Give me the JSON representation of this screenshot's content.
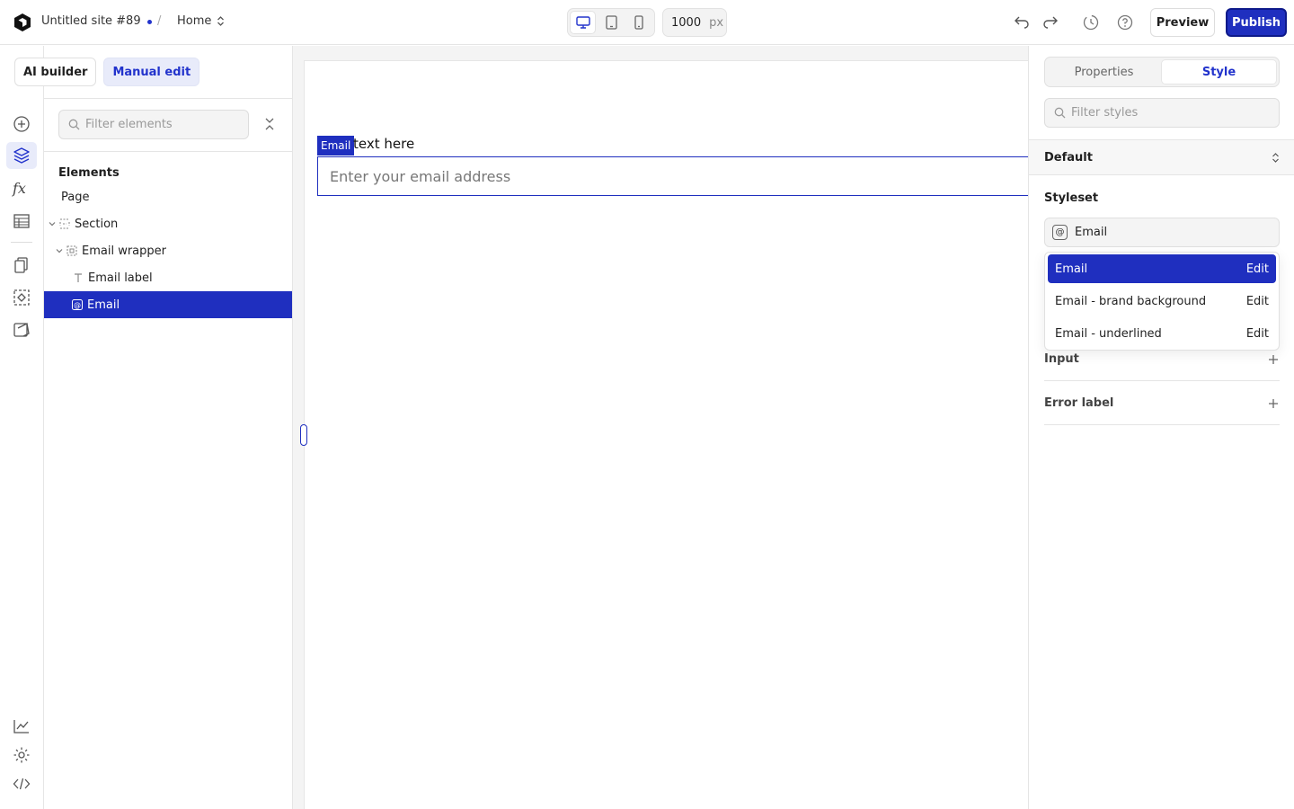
{
  "topbar": {
    "site_name": "Untitled site #89",
    "separator": "/",
    "page": "Home",
    "canvas_width": "1000",
    "canvas_unit": "px",
    "preview_label": "Preview",
    "publish_label": "Publish"
  },
  "left_panel": {
    "mode_tabs": [
      "AI builder",
      "Manual edit"
    ],
    "filter_placeholder": "Filter elements",
    "elements_title": "Elements",
    "tree": [
      {
        "label": "Page"
      },
      {
        "label": "Section"
      },
      {
        "label": "Email wrapper"
      },
      {
        "label": "Email label"
      },
      {
        "label": "Email"
      }
    ]
  },
  "canvas": {
    "element_tag": "Email",
    "label_text": "text here",
    "input_placeholder": "Enter your email address"
  },
  "right_panel": {
    "tabs": [
      "Properties",
      "Style"
    ],
    "filter_placeholder": "Filter styles",
    "state": "Default",
    "styleset_title": "Styleset",
    "styleset_badge": "@",
    "styleset_selected": "Email",
    "dropdown": [
      {
        "label": "Email",
        "action": "Edit"
      },
      {
        "label": "Email - brand background",
        "action": "Edit"
      },
      {
        "label": "Email - underlined",
        "action": "Edit"
      }
    ],
    "sections": [
      "Input",
      "Error label"
    ]
  },
  "colors": {
    "accent": "#1f2fbf",
    "accent_light": "#e8ebfa"
  }
}
